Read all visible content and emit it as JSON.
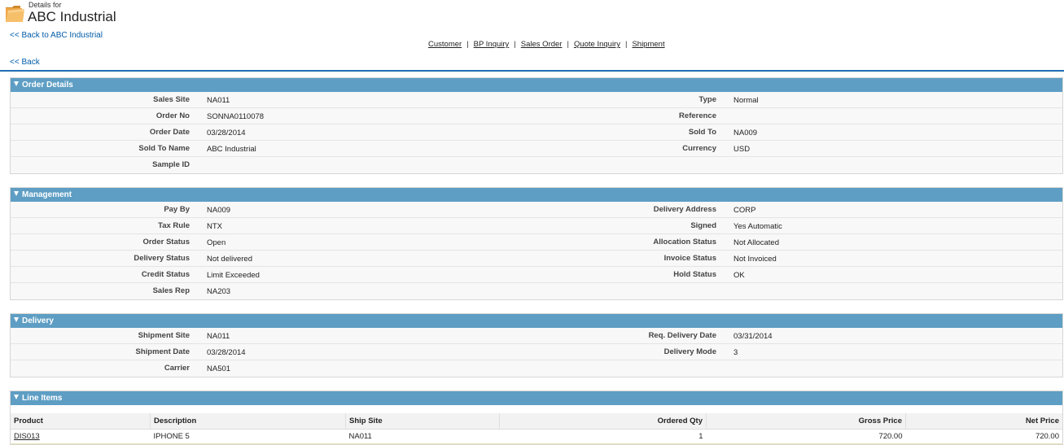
{
  "header": {
    "details_for": "Details for",
    "account_name": "ABC Industrial",
    "back_to_account": "<< Back to ABC Industrial",
    "back": "<< Back"
  },
  "nav": {
    "links": [
      "Customer",
      "BP Inquiry",
      "Sales Order",
      "Quote Inquiry",
      "Shipment"
    ]
  },
  "order_details": {
    "title": "Order Details",
    "left": [
      {
        "label": "Sales Site",
        "value": "NA011"
      },
      {
        "label": "Order No",
        "value": "SONNA0110078"
      },
      {
        "label": "Order Date",
        "value": "03/28/2014"
      },
      {
        "label": "Sold To Name",
        "value": "ABC Industrial"
      },
      {
        "label": "Sample ID",
        "value": ""
      }
    ],
    "right": [
      {
        "label": "Type",
        "value": "Normal"
      },
      {
        "label": "Reference",
        "value": ""
      },
      {
        "label": "Sold To",
        "value": "NA009"
      },
      {
        "label": "Currency",
        "value": "USD"
      }
    ]
  },
  "management": {
    "title": "Management",
    "left": [
      {
        "label": "Pay By",
        "value": "NA009"
      },
      {
        "label": "Tax Rule",
        "value": "NTX"
      },
      {
        "label": "Order Status",
        "value": "Open"
      },
      {
        "label": "Delivery Status",
        "value": "Not delivered"
      },
      {
        "label": "Credit Status",
        "value": "Limit Exceeded"
      },
      {
        "label": "Sales Rep",
        "value": "NA203"
      }
    ],
    "right": [
      {
        "label": "Delivery Address",
        "value": "CORP"
      },
      {
        "label": "Signed",
        "value": "Yes Automatic"
      },
      {
        "label": "Allocation Status",
        "value": "Not Allocated"
      },
      {
        "label": "Invoice Status",
        "value": "Not Invoiced"
      },
      {
        "label": "Hold Status",
        "value": "OK"
      }
    ]
  },
  "delivery": {
    "title": "Delivery",
    "left": [
      {
        "label": "Shipment Site",
        "value": "NA011"
      },
      {
        "label": "Shipment Date",
        "value": "03/28/2014"
      },
      {
        "label": "Carrier",
        "value": "NA501"
      }
    ],
    "right": [
      {
        "label": "Req. Delivery Date",
        "value": "03/31/2014"
      },
      {
        "label": "Delivery Mode",
        "value": "3"
      }
    ]
  },
  "line_items": {
    "title": "Line Items",
    "columns": [
      "Product",
      "Description",
      "Ship Site",
      "Ordered Qty",
      "Gross Price",
      "Net Price"
    ],
    "rows": [
      {
        "product": "DIS013",
        "description": "IPHONE 5",
        "ship_site": "NA011",
        "qty": "1",
        "gross": "720.00",
        "net": "720.00"
      }
    ]
  },
  "colors": {
    "section_header": "#5e9ec4",
    "link": "#015ba7",
    "header_rule": "#1f6fb5"
  }
}
